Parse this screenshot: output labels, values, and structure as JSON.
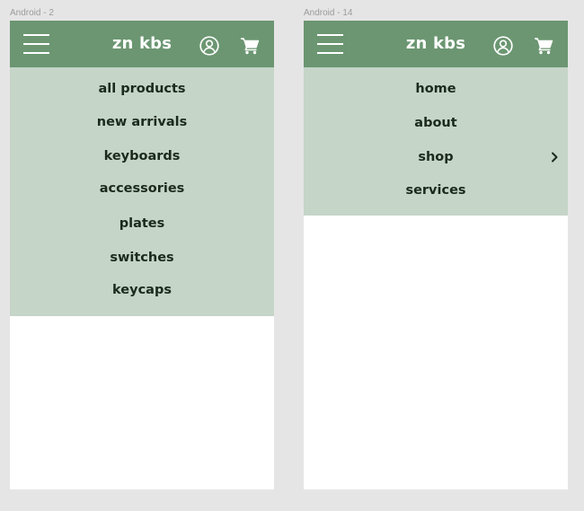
{
  "frames": [
    {
      "label": "Android - 2",
      "brand": "zn kbs",
      "menu_items": [
        {
          "label": "all products"
        },
        {
          "label": "new arrivals"
        },
        {
          "label": "keyboards"
        },
        {
          "label": "accessories"
        },
        {
          "label": "plates"
        },
        {
          "label": "switches"
        },
        {
          "label": "keycaps"
        }
      ]
    },
    {
      "label": "Android - 14",
      "brand": "zn kbs",
      "menu_items": [
        {
          "label": "home"
        },
        {
          "label": "about"
        },
        {
          "label": "shop",
          "has_submenu": true
        },
        {
          "label": "services"
        }
      ]
    }
  ],
  "colors": {
    "header": "#6b9671",
    "menu_bg": "#c5d5c8",
    "menu_text": "#1b2a1d",
    "canvas_bg": "#e5e5e5"
  },
  "icons": {
    "menu": "hamburger-icon",
    "account": "user-circle-icon",
    "cart": "shopping-cart-icon",
    "submenu": "chevron-right-icon"
  }
}
